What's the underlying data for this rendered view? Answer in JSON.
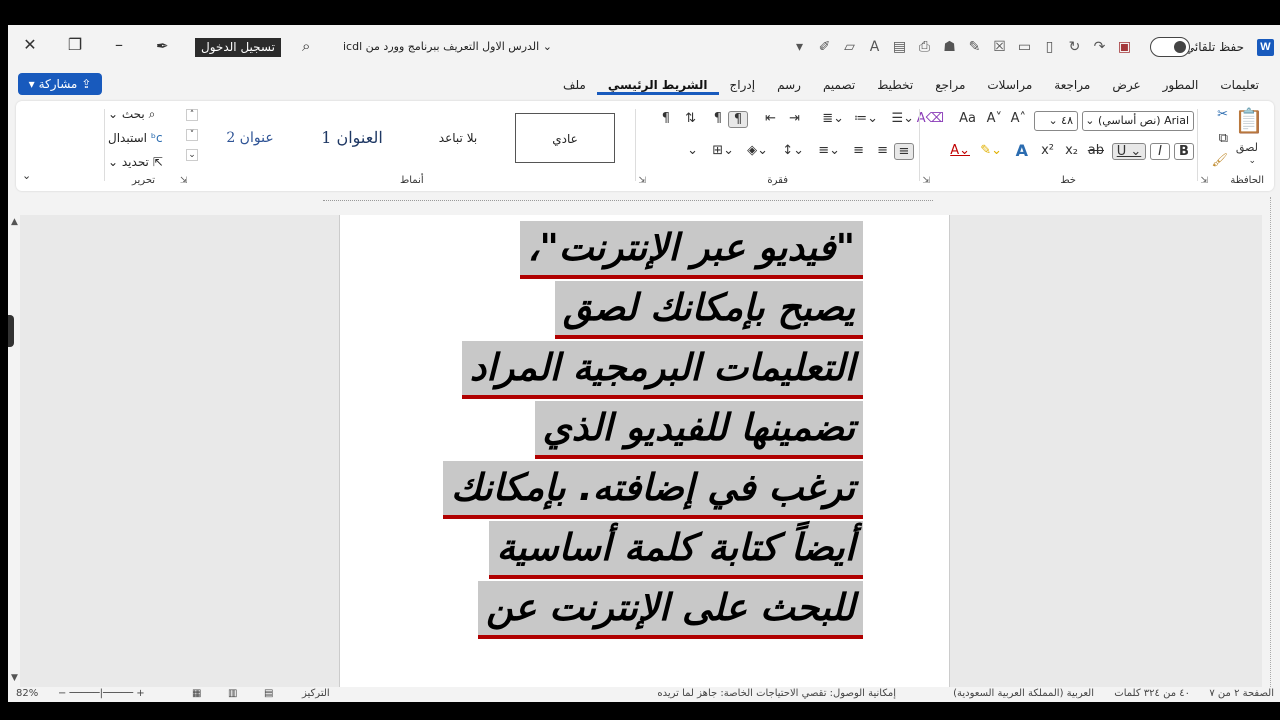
{
  "titlebar": {
    "autosave_label": "حفظ تلقائي",
    "doc_title": "الدرس الاول التعريف ببرنامج وورد من icdl",
    "signin_label": "تسجيل الدخول",
    "word_icon_letter": "W"
  },
  "share": {
    "label": "مشاركة"
  },
  "tabs": [
    "ملف",
    "الشريط الرئيسي",
    "إدراج",
    "رسم",
    "تصميم",
    "تخطيط",
    "مراجع",
    "مراسلات",
    "مراجعة",
    "عرض",
    "المطور",
    "تعليمات"
  ],
  "ribbon": {
    "clipboard": {
      "paste_label": "لصق",
      "group_label": "الحافظة"
    },
    "font": {
      "font_name": "Arial (نص أساسي)",
      "font_size": "٤٨",
      "group_label": "خط"
    },
    "paragraph": {
      "group_label": "فقرة"
    },
    "styles": {
      "group_label": "أنماط",
      "items": [
        "عادي",
        "بلا تباعد",
        "العنوان 1",
        "عنوان 2"
      ]
    },
    "editing": {
      "group_label": "تحرير",
      "find_label": "بحث",
      "replace_label": "استبدال",
      "select_label": "تحديد"
    }
  },
  "document": {
    "lines": [
      "\"فيديو عبر الإنترنت\"،",
      "يصبح بإمكانك لصق",
      "التعليمات البرمجية المراد",
      "تضمينها للفيديو الذي",
      "ترغب في إضافته. بإمكانك",
      "أيضاً كتابة كلمة أساسية",
      "للبحث على الإنترنت عن"
    ]
  },
  "statusbar": {
    "page": "الصفحة ٢ من ٧",
    "words": "٤٠ من ٣٢٤ كلمات",
    "language": "العربية (المملكة العربية السعودية)",
    "accessibility": "إمكانية الوصول: تقصي الاحتياجات الخاصة: جاهز لما تريده",
    "focus": "التركيز",
    "zoom": "82%"
  },
  "colors": {
    "accent": "#185abd",
    "underline": "#b00000",
    "highlight": "#c8c8c8"
  }
}
